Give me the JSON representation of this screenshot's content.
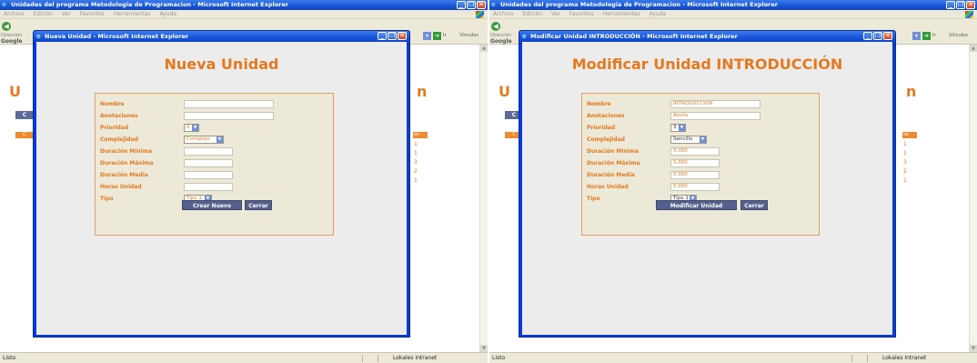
{
  "common": {
    "bg_window_title": "Unidades del programa Metodologia de Programacion - Microsoft Internet Explorer",
    "menu": [
      "Archivo",
      "Edición",
      "Ver",
      "Favoritos",
      "Herramientas",
      "Ayuda"
    ],
    "address_label": "Dirección",
    "google_label": "Google",
    "go_label": "Ir",
    "links_label": "Vínculos",
    "bg_heading_left_letter": "U",
    "bg_heading_right_letter": "n",
    "bg_button_label": "C",
    "bg_column_label": "C",
    "bg_column_right_label": "so",
    "bg_column_numbers": [
      "1",
      "1",
      "3",
      "2",
      "1"
    ],
    "status_ready": "Listo",
    "status_zone": "Lokales Intranet",
    "field_labels": [
      "Nombre",
      "Anotaciones",
      "Prioridad",
      "Complejidad",
      "Duración Mínima",
      "Duración Máxima",
      "Duración Media",
      "Horas Unidad",
      "Tipo"
    ],
    "close_button": "Cerrar"
  },
  "new_unit": {
    "popup_title": "Nueva Unidad - Microsoft Internet Explorer",
    "heading": "Nueva Unidad",
    "values": {
      "nombre": "",
      "anotaciones": "",
      "prioridad": "0",
      "complejidad": "Complejo",
      "duracion_minima": "",
      "duracion_maxima": "",
      "duracion_media": "",
      "horas_unidad": "",
      "tipo": "Tipo 1"
    },
    "submit_button": "Crear Nuevo"
  },
  "edit_unit": {
    "popup_title": "Modificar Unidad INTRODUCCIÓN - Microsoft Internet Explorer",
    "heading": "Modificar Unidad INTRODUCCIÓN",
    "values": {
      "nombre": "INTRODUCCIÓN",
      "anotaciones": "Anota",
      "prioridad": "3",
      "complejidad": "Sencillo",
      "duracion_minima": "5.000",
      "duracion_maxima": "5.000",
      "duracion_media": "5.000",
      "horas_unidad": "5.000",
      "tipo": "Tipo 1"
    },
    "submit_button": "Modificar Unidad"
  },
  "colors": {
    "accent_orange": "#e37a1f",
    "xp_blue": "#0a3bd8",
    "button_slate": "#55608c",
    "form_bg": "#ece9d8"
  }
}
